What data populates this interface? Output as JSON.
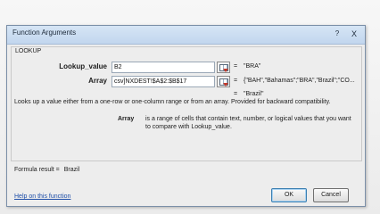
{
  "window": {
    "title": "Function Arguments",
    "help_symbol": "?",
    "close_symbol": "X"
  },
  "function_name": "LOOKUP",
  "arguments": [
    {
      "label": "Lookup_value",
      "value": "B2",
      "result_eq": "=",
      "result": "\"BRA\""
    },
    {
      "label": "Array",
      "value": "csv]NXDEST!$A$2:$B$17",
      "result_eq": "=",
      "result": "{\"BAH\",\"Bahamas\";\"BRA\",\"Brazil\";\"CO..."
    }
  ],
  "overall_result": {
    "eq": "=",
    "value": "\"Brazil\""
  },
  "description": "Looks up a value either from a one-row or one-column range or from an array. Provided for backward compatibility.",
  "arg_help": {
    "name": "Array",
    "text_line1": "is a range of cells that contain text, number, or logical values that you want",
    "text_line2": "to compare with Lookup_value."
  },
  "formula_result": {
    "label": "Formula result =",
    "value": "Brazil"
  },
  "help_link": "Help on this function",
  "buttons": {
    "ok": "OK",
    "cancel": "Cancel"
  }
}
